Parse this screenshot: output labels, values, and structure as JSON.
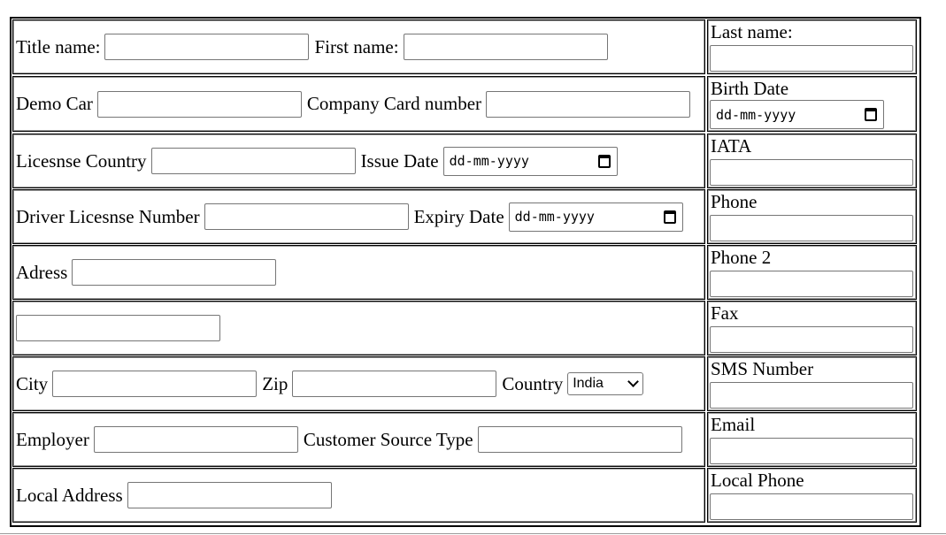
{
  "left_rows": [
    {
      "a_label": "Title name:",
      "b_label": "First name:"
    },
    {
      "a_label": "Demo Car",
      "b_label": "Company Card number"
    },
    {
      "a_label": "Licesnse Country",
      "b_label": "Issue Date",
      "b_placeholder": "dd-mm-yyyy"
    },
    {
      "a_label": "Driver Licesnse Number",
      "b_label": "Expiry Date",
      "b_placeholder": "dd-mm-yyyy"
    },
    {
      "a_label": "Adress"
    },
    {},
    {
      "a_label": "City",
      "b_label": "Zip",
      "c_label": "Country",
      "c_value": "India"
    },
    {
      "a_label": "Employer",
      "b_label": "Customer Source Type"
    },
    {
      "a_label": "Local Address"
    }
  ],
  "right_rows": [
    {
      "label": "Last name:"
    },
    {
      "label": "Birth Date",
      "placeholder": "dd-mm-yyyy"
    },
    {
      "label": "IATA"
    },
    {
      "label": "Phone"
    },
    {
      "label": "Phone 2"
    },
    {
      "label": "Fax"
    },
    {
      "label": "SMS Number"
    },
    {
      "label": "Email"
    },
    {
      "label": "Local Phone"
    }
  ],
  "icons": {
    "date_picker": "calendar-icon",
    "select_arrow": "chevron-down-icon"
  }
}
